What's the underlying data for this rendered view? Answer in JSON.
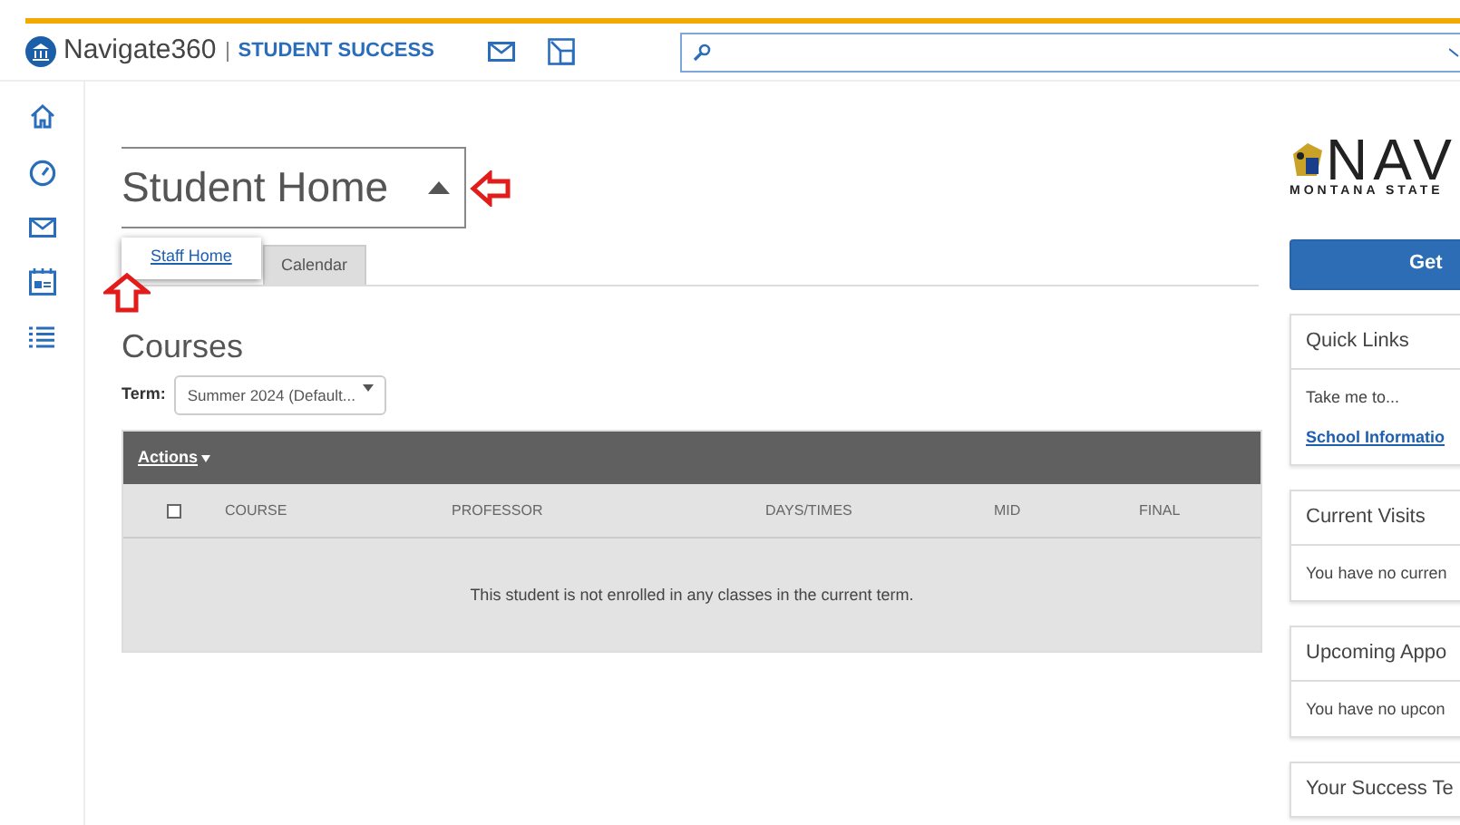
{
  "header": {
    "brand": "Navigate360",
    "product": "STUDENT SUCCESS"
  },
  "page_title": {
    "text": "Student Home",
    "expanded": true
  },
  "title_menu": [
    {
      "label": "Staff Home"
    }
  ],
  "tabs": [
    {
      "label": "Calendar",
      "selected": false
    }
  ],
  "courses": {
    "title": "Courses",
    "term_label": "Term:",
    "term_value": "Summer 2024 (Default...",
    "actions": "Actions",
    "columns": [
      {
        "label": "COURSE"
      },
      {
        "label": "PROFESSOR"
      },
      {
        "label": "DAYS/TIMES"
      },
      {
        "label": "MID"
      },
      {
        "label": "FINAL"
      }
    ],
    "select_all_checked": false,
    "empty_message": "This student is not enrolled in any classes in the current term."
  },
  "right_panel": {
    "logo_text": "NAV",
    "logo_subtext": "MONTANA STATE",
    "button": "Get",
    "cards": [
      {
        "title": "Quick Links",
        "lines": [
          {
            "text": "Take me to...",
            "kind": "text"
          },
          {
            "text": "School Informatio",
            "kind": "link"
          }
        ]
      },
      {
        "title": "Current Visits",
        "lines": [
          {
            "text": "You have no curren",
            "kind": "text"
          }
        ]
      },
      {
        "title": "Upcoming Appo",
        "lines": [
          {
            "text": "You have no upcon",
            "kind": "text"
          }
        ]
      },
      {
        "title": "Your Success Te"
      }
    ]
  }
}
